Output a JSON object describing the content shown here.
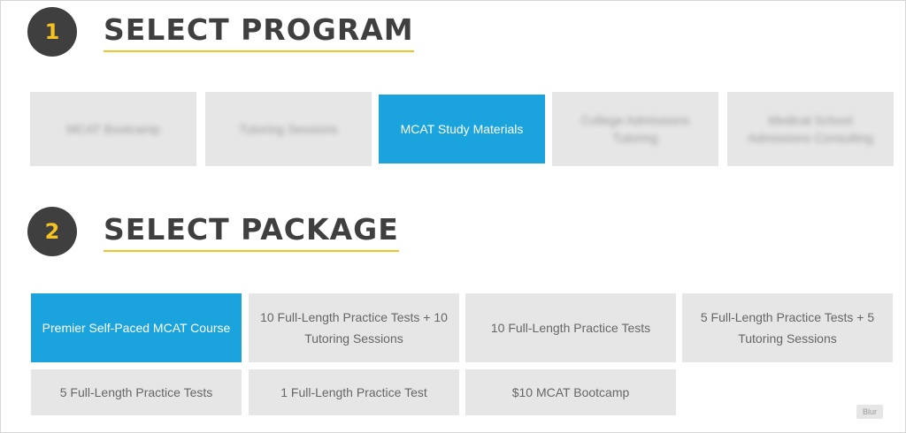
{
  "step1": {
    "number": "1",
    "title": "SELECT PROGRAM"
  },
  "programs": [
    {
      "label": "MCAT Bootcamp",
      "selected": false
    },
    {
      "label": "Tutoring Sessions",
      "selected": false
    },
    {
      "label": "MCAT Study Materials",
      "selected": true
    },
    {
      "label": "College Admissions Tutoring",
      "selected": false
    },
    {
      "label": "Medical School Admissions Consulting",
      "selected": false
    }
  ],
  "step2": {
    "number": "2",
    "title": "SELECT PACKAGE"
  },
  "packages": [
    {
      "label": "Premier Self-Paced MCAT Course",
      "selected": true
    },
    {
      "label": "10 Full-Length Practice Tests + 10 Tutoring Sessions",
      "selected": false
    },
    {
      "label": "10 Full-Length Practice Tests",
      "selected": false
    },
    {
      "label": "5 Full-Length Practice Tests + 5 Tutoring Sessions",
      "selected": false
    },
    {
      "label": "5 Full-Length Practice Tests",
      "selected": false
    },
    {
      "label": "1 Full-Length Practice Test",
      "selected": false
    },
    {
      "label": "$10 MCAT Bootcamp",
      "selected": false
    }
  ],
  "badge": {
    "label": "Blur"
  },
  "colors": {
    "accent": "#1aa3dd",
    "underline": "#f4c321",
    "heading": "#3f3f3f",
    "tile": "#e6e6e6"
  }
}
